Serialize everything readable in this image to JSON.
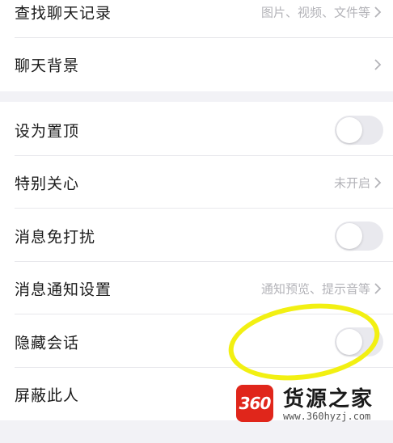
{
  "rows": {
    "search_history": {
      "label": "查找聊天记录",
      "detail": "图片、视频、文件等"
    },
    "chat_background": {
      "label": "聊天背景"
    },
    "pin_to_top": {
      "label": "设为置顶",
      "toggle_on": false
    },
    "special_care": {
      "label": "特别关心",
      "detail": "未开启"
    },
    "do_not_disturb": {
      "label": "消息免打扰",
      "toggle_on": false
    },
    "notification_settings": {
      "label": "消息通知设置",
      "detail": "通知预览、提示音等"
    },
    "hide_conversation": {
      "label": "隐藏会话",
      "toggle_on": false
    },
    "block_user": {
      "label": "屏蔽此人"
    }
  },
  "watermark": {
    "logo": "360",
    "title": "货源之家",
    "url": "www.360hyzj.com"
  },
  "colors": {
    "highlight_ring": "#f2f012",
    "logo_red": "#e0261b",
    "toggle_off": "#e9e9ee"
  },
  "icons": {
    "row_chevron": "chevron-right-icon"
  }
}
